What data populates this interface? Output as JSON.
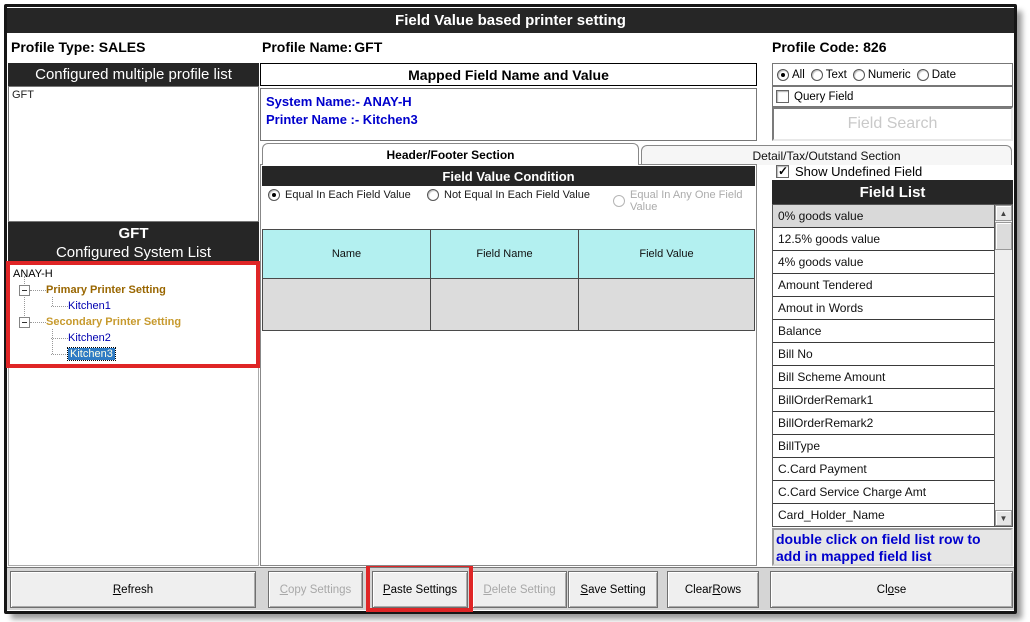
{
  "window": {
    "title": "Field Value based printer setting"
  },
  "header": {
    "profile_type_label": "Profile Type:",
    "profile_type_value": "SALES",
    "profile_name_label": "Profile Name:",
    "profile_name_value": "GFT",
    "profile_code_label": "Profile Code:",
    "profile_code_value": "826"
  },
  "profile_list": {
    "header": "Configured multiple profile list",
    "items": [
      "GFT"
    ]
  },
  "system_list": {
    "title_line1": "GFT",
    "title_line2": "Configured System List",
    "root": "ANAY-H",
    "groups": [
      {
        "label": "Primary Printer Setting",
        "children": [
          "Kitchen1"
        ]
      },
      {
        "label": "Secondary Printer Setting",
        "children": [
          "Kitchen2",
          "Kitchen3"
        ]
      }
    ],
    "selected_child": "Kitchen3"
  },
  "mapped_panel": {
    "header": "Mapped Field Name and Value",
    "system_name_line": "System Name:- ANAY-H",
    "printer_name_line": "Printer Name :- Kitchen3"
  },
  "filter": {
    "options": [
      "All",
      "Text",
      "Numeric",
      "Date"
    ],
    "selected": "All",
    "query_field_label": "Query Field",
    "query_checked": false,
    "search_placeholder": "Field Search"
  },
  "tabs": {
    "active": "Header/Footer Section",
    "inactive": "Detail/Tax/Outstand Section"
  },
  "condition": {
    "header": "Field Value Condition",
    "options": [
      {
        "label": "Equal In Each Field Value",
        "selected": true,
        "disabled": false
      },
      {
        "label": "Not Equal In Each Field Value",
        "selected": false,
        "disabled": false
      },
      {
        "label": "Equal In Any One Field Value",
        "selected": false,
        "disabled": true
      }
    ]
  },
  "mapped_table": {
    "columns": [
      "Name",
      "Field Name",
      "Field Value"
    ],
    "rows": [
      [
        "",
        "",
        ""
      ]
    ]
  },
  "field_list_panel": {
    "show_undefined_label": "Show Undefined Field",
    "show_undefined_checked": true,
    "header": "Field List",
    "items": [
      "0% goods value",
      "12.5% goods value",
      "4% goods value",
      "Amount Tendered",
      "Amout in Words",
      "Balance",
      "Bill No",
      "Bill Scheme Amount",
      "BillOrderRemark1",
      "BillOrderRemark2",
      "BillType",
      "C.Card Payment",
      "C.Card Service Charge Amt",
      "Card_Holder_Name"
    ],
    "hint": "double click on field list row to add in mapped field list"
  },
  "toolbar": {
    "buttons": [
      {
        "label": "Refresh",
        "mnemonic_index": 0,
        "disabled": false,
        "highlighted": false
      },
      {
        "label": "Copy Settings",
        "mnemonic_index": 0,
        "disabled": true,
        "highlighted": false
      },
      {
        "label": "Paste Settings",
        "mnemonic_index": 0,
        "disabled": false,
        "highlighted": true
      },
      {
        "label": "Delete Setting",
        "mnemonic_index": 0,
        "disabled": true,
        "highlighted": false
      },
      {
        "label": "Save Setting",
        "mnemonic_index": 0,
        "disabled": false,
        "highlighted": false
      },
      {
        "label": "Clear Rows",
        "mnemonic_index": 6,
        "disabled": false,
        "highlighted": false
      },
      {
        "label": "Close",
        "mnemonic_index": 2,
        "disabled": false,
        "highlighted": false
      }
    ]
  },
  "annotation": {
    "color": "#DF2526"
  },
  "colors": {
    "accent_cyan": "#B3F0F0",
    "header_black": "#262626",
    "link_blue": "#0000CC",
    "tree_primary": "#996600",
    "tree_secondary": "#C79A2E",
    "tree_item_blue": "#0000B0",
    "selection_blue": "#2E7BC4"
  }
}
